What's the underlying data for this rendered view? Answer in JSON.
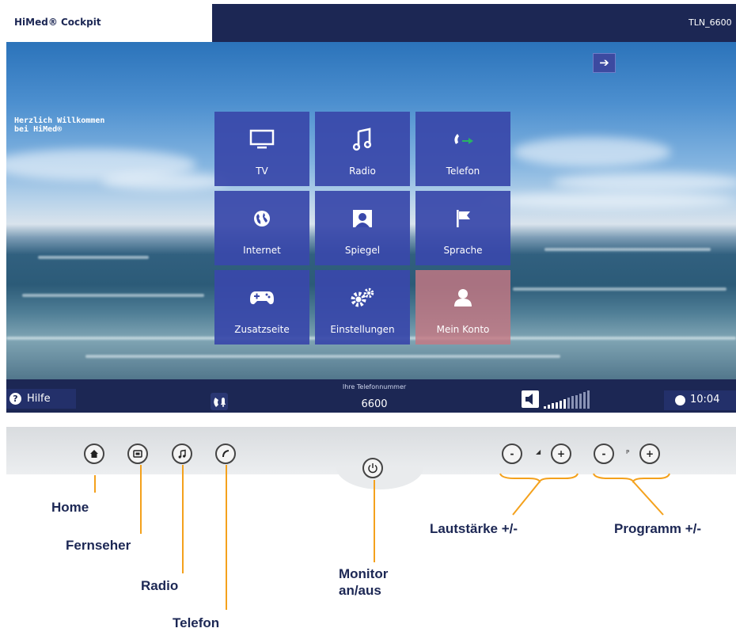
{
  "screen": {
    "brand": "HiMed® Cockpit",
    "user_id": "TLN_6600",
    "welcome": "Herzlich Willkommen\nbei HiMed®",
    "tiles": [
      {
        "label": "TV",
        "icon": "tv-icon"
      },
      {
        "label": "Radio",
        "icon": "music-note-icon"
      },
      {
        "label": "Telefon",
        "icon": "phone-icon"
      },
      {
        "label": "Internet",
        "icon": "globe-icon"
      },
      {
        "label": "Spiegel",
        "icon": "portrait-icon"
      },
      {
        "label": "Sprache",
        "icon": "flag-icon"
      },
      {
        "label": "Zusatzseite",
        "icon": "gamepad-icon"
      },
      {
        "label": "Einstellungen",
        "icon": "gears-icon"
      },
      {
        "label": "Mein Konto",
        "icon": "user-icon",
        "active": true
      }
    ],
    "help_label": "Hilfe",
    "phone_caption": "Ihre Telefonnummer",
    "phone_number": "6600",
    "time": "10:04",
    "volume_level": 0.5,
    "colors": {
      "tile": "#3948aa",
      "active_tile": "#c47882",
      "bar": "#1c2754"
    }
  },
  "device": {
    "p_mark": "P",
    "minus": "-",
    "plus": "+"
  },
  "callouts": {
    "home": "Home",
    "tv": "Fernseher",
    "radio": "Radio",
    "telefon": "Telefon",
    "monitor": "Monitor\nan/aus",
    "volume": "Lautstärke +/-",
    "program": "Programm +/-"
  }
}
